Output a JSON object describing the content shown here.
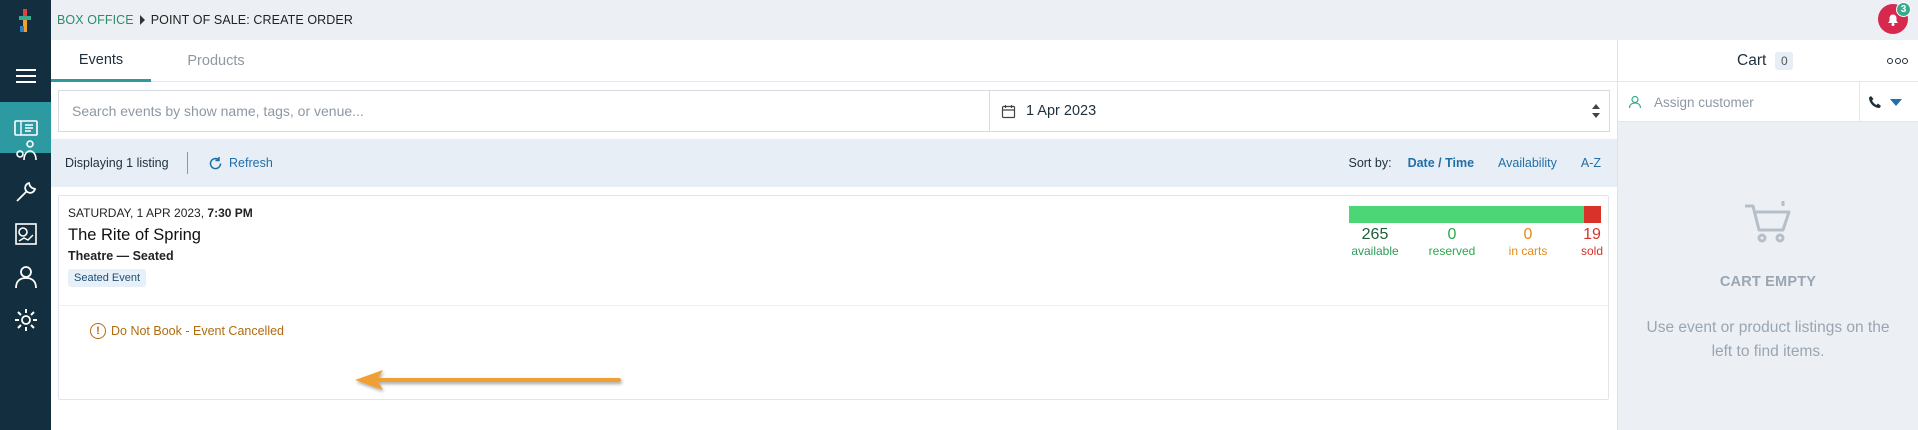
{
  "breadcrumb": {
    "section": "BOX OFFICE",
    "page": "POINT OF SALE: CREATE ORDER"
  },
  "notifications": {
    "count": "3",
    "icon": "notification-bell-icon",
    "color": "#d6294d"
  },
  "sidebar": {
    "items": [
      {
        "icon": "menu-icon"
      },
      {
        "icon": "ticket-icon",
        "active": true
      },
      {
        "icon": "attendees-icon"
      },
      {
        "icon": "wrench-icon"
      },
      {
        "icon": "reports-icon"
      },
      {
        "icon": "user-icon"
      },
      {
        "icon": "settings-icon"
      }
    ],
    "active_color": "#2c9aa0"
  },
  "tabs": [
    {
      "label": "Events",
      "active": true
    },
    {
      "label": "Products",
      "active": false
    }
  ],
  "search": {
    "placeholder": "Search events by show name, tags, or venue...",
    "value": ""
  },
  "date_filter": {
    "value": "1 Apr 2023"
  },
  "listing_bar": {
    "displaying": "Displaying 1 listing",
    "refresh": "Refresh",
    "sort_label": "Sort by:",
    "sort_options": [
      "Date / Time",
      "Availability",
      "A-Z"
    ],
    "sort_selected": "Date / Time"
  },
  "event": {
    "date": "SATURDAY, 1 APR 2023,",
    "time": "7:30 PM",
    "title": "The Rite of Spring",
    "venue": "Theatre — Seated",
    "tag": "Seated Event",
    "warning": "Do Not Book - Event Cancelled",
    "stats": {
      "available": {
        "value": "265",
        "label": "available",
        "color": "#4dd676"
      },
      "reserved": {
        "value": "0",
        "label": "reserved"
      },
      "in_carts": {
        "value": "0",
        "label": "in carts"
      },
      "sold": {
        "value": "19",
        "label": "sold",
        "color": "#d8322b"
      }
    },
    "capacity_fill": {
      "available": 265,
      "sold": 19
    }
  },
  "cart": {
    "title": "Cart",
    "count": "0",
    "assign_placeholder": "Assign customer",
    "empty_title": "CART EMPTY",
    "empty_text": "Use event or product listings on the left to find items."
  }
}
